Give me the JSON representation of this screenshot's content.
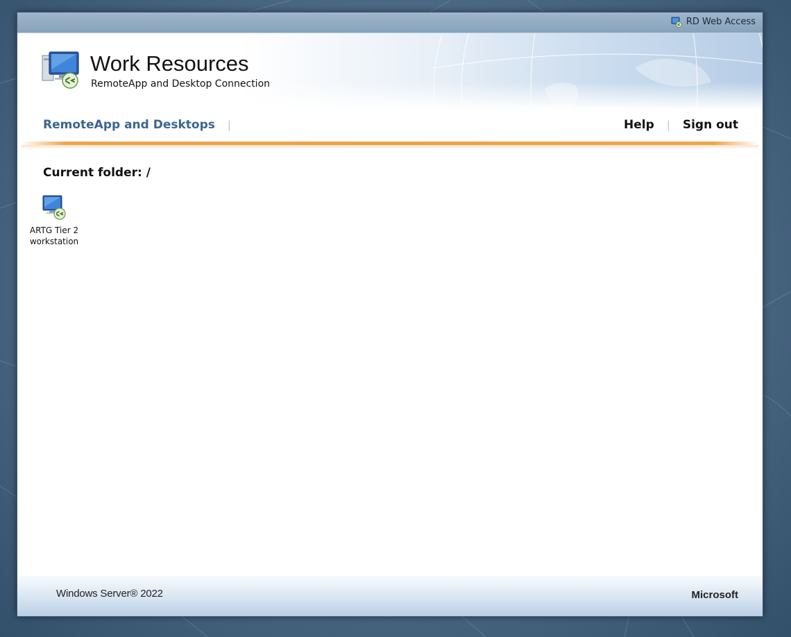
{
  "topbar": {
    "product_name": "RD Web Access",
    "icon": "rd-web-access-icon"
  },
  "header": {
    "title": "Work Resources",
    "subtitle": "RemoteApp and Desktop Connection",
    "logo_icon": "remote-desktop-logo-icon"
  },
  "nav": {
    "tab_remoteapp": "RemoteApp and Desktops",
    "separator": "|",
    "help": "Help",
    "sign_out": "Sign out"
  },
  "content": {
    "current_folder_label": "Current folder: /",
    "resources": [
      {
        "name_line1": "ARTG Tier 2",
        "name_line2": "workstation",
        "icon": "remote-desktop-icon"
      }
    ]
  },
  "footer": {
    "os_name": "Windows Server® 2022",
    "vendor": "Microsoft"
  },
  "colors": {
    "nav_tab": "#3c6591",
    "accent_bar": "#f0a54a",
    "topbar": "#8fa9c1"
  }
}
